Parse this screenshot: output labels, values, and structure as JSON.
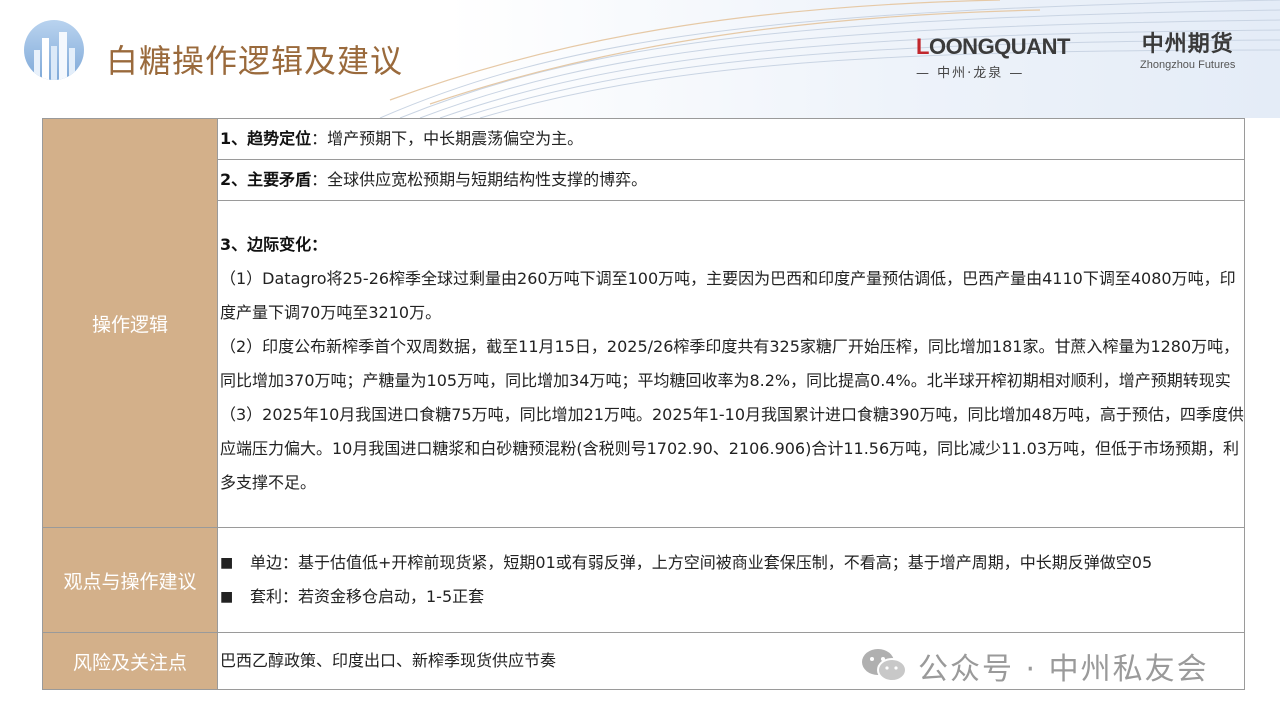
{
  "header": {
    "title": "白糖操作逻辑及建议",
    "brand1_name_first": "L",
    "brand1_name_rest": "OONGQUANT",
    "brand1_sub": "— 中州·龙泉 —",
    "brand2_name": "中州期货",
    "brand2_sub": "Zhongzhou Futures"
  },
  "rows": {
    "logic_label": "操作逻辑",
    "advice_label": "观点与操作建议",
    "risk_label": "风险及关注点"
  },
  "logic": {
    "item1_title": "1、趋势定位",
    "item1_text": "：增产预期下，中长期震荡偏空为主。",
    "item2_title": "2、主要矛盾",
    "item2_text": "：全球供应宽松预期与短期结构性支撑的博弈。",
    "item3_title": "3、边际变化：",
    "p1": "（1）Datagro将25-26榨季全球过剩量由260万吨下调至100万吨，主要因为巴西和印度产量预估调低，巴西产量由4110下调至4080万吨，印度产量下调70万吨至3210万。",
    "p2": "（2）印度公布新榨季首个双周数据，截至11月15日，2025/26榨季印度共有325家糖厂开始压榨，同比增加181家。甘蔗入榨量为1280万吨，同比增加370万吨；产糖量为105万吨，同比增加34万吨；平均糖回收率为8.2%，同比提高0.4%。北半球开榨初期相对顺利，增产预期转现实",
    "p3": "（3）2025年10月我国进口食糖75万吨，同比增加21万吨。2025年1-10月我国累计进口食糖390万吨，同比增加48万吨，高于预估，四季度供应端压力偏大。10月我国进口糖浆和白砂糖预混粉(含税则号1702.90、2106.906)合计11.56万吨，同比减少11.03万吨，但低于市场预期，利多支撑不足。"
  },
  "advice": {
    "bullet": "■",
    "b1": "单边：基于估值低+开榨前现货紧，短期01或有弱反弹，上方空间被商业套保压制，不看高；基于增产周期，中长期反弹做空05",
    "b2": "套利：若资金移仓启动，1-5正套"
  },
  "risk": {
    "text": "巴西乙醇政策、印度出口、新榨季现货供应节奏"
  },
  "watermark": {
    "text": "公众号 · 中州私友会"
  },
  "colors": {
    "title": "#9a6a3c",
    "label_bg": "#d3b08a",
    "brand_red": "#c1272d"
  }
}
